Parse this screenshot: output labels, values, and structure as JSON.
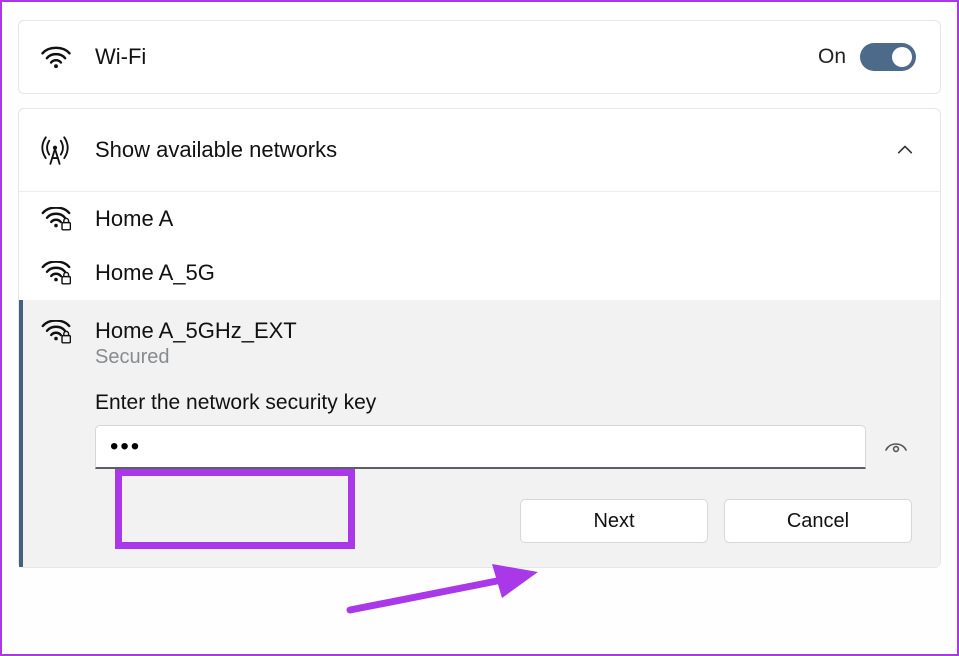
{
  "wifi": {
    "title": "Wi-Fi",
    "status": "On",
    "enabled": true
  },
  "networks_section": {
    "title": "Show available networks",
    "expanded": true
  },
  "networks": [
    {
      "name": "Home A",
      "secured": true
    },
    {
      "name": "Home A_5G",
      "secured": true
    }
  ],
  "selected_network": {
    "name": "Home A_5GHz_EXT",
    "status_label": "Secured",
    "prompt": "Enter the network security key",
    "password_value": "•••",
    "buttons": {
      "next": "Next",
      "cancel": "Cancel"
    }
  }
}
